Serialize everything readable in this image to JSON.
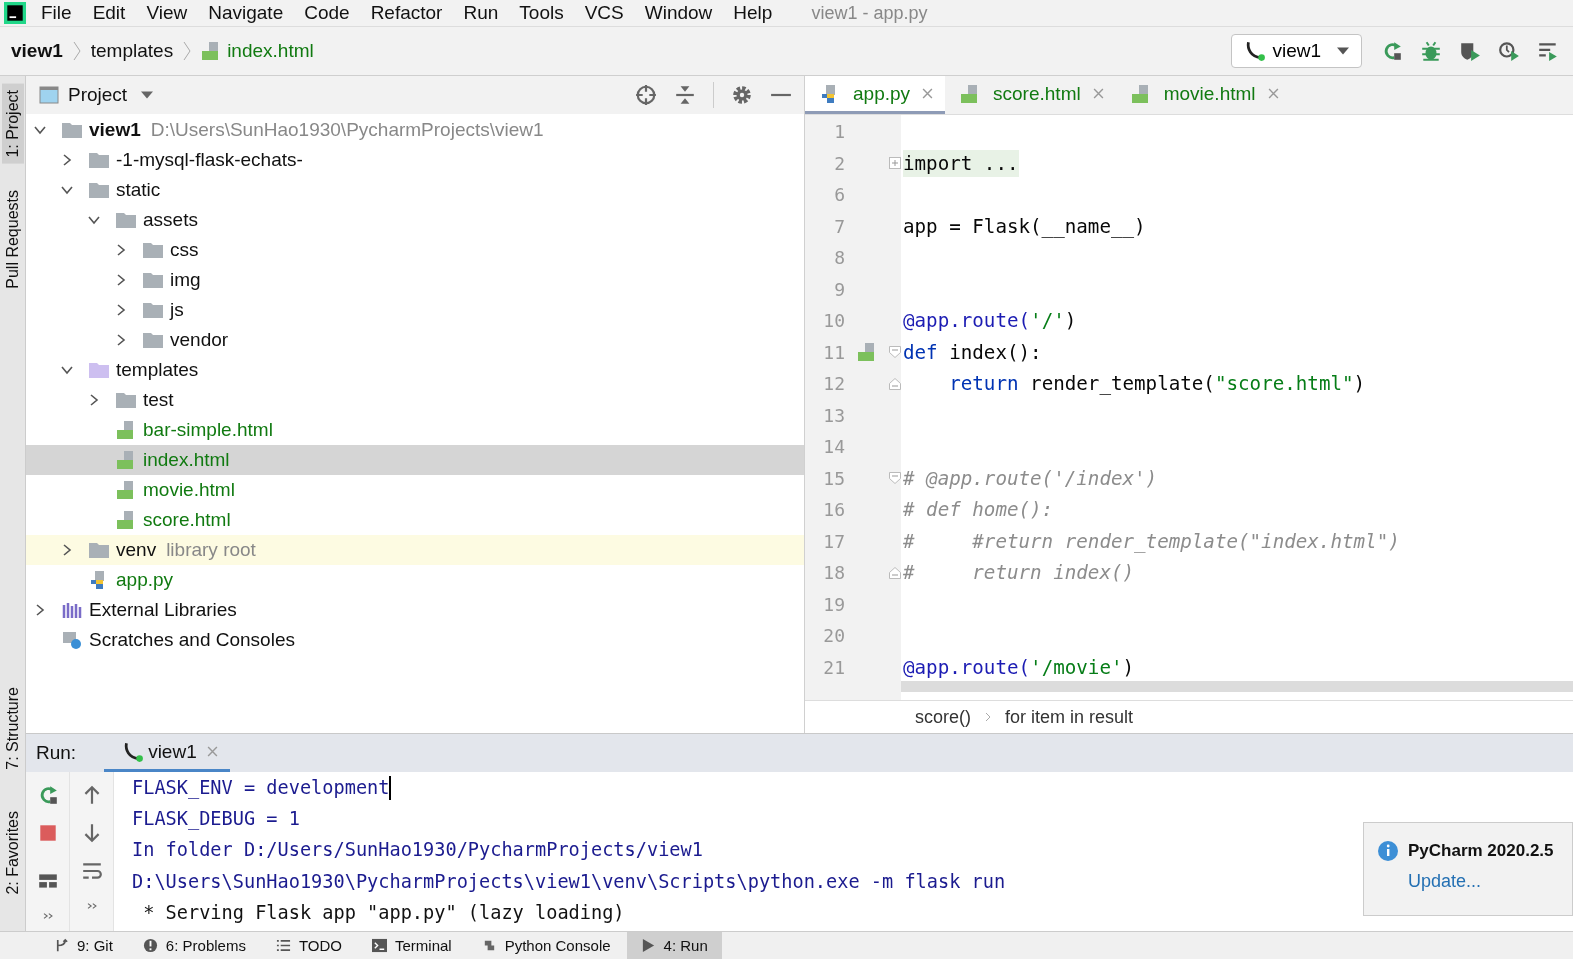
{
  "menu": [
    "File",
    "Edit",
    "View",
    "Navigate",
    "Code",
    "Refactor",
    "Run",
    "Tools",
    "VCS",
    "Window",
    "Help"
  ],
  "window": {
    "title": "view1 - app.py"
  },
  "breadcrumb": [
    {
      "label": "view1",
      "kind": "project"
    },
    {
      "label": "templates",
      "kind": "folder"
    },
    {
      "label": "index.html",
      "kind": "html"
    }
  ],
  "run_config": {
    "label": "view1"
  },
  "side_tabs": [
    {
      "label": "1: Project",
      "selected": true,
      "kind": "project"
    },
    {
      "label": "Pull Requests",
      "selected": false,
      "kind": "pull"
    },
    {
      "label": "7: Structure",
      "selected": false,
      "kind": "structure"
    },
    {
      "label": "2: Favorites",
      "selected": false,
      "kind": "favorites"
    }
  ],
  "project": {
    "title": "Project",
    "tree": [
      {
        "name": "view1",
        "path": "D:\\Users\\SunHao1930\\PycharmProjects\\view1",
        "kind": "root",
        "expanded": true,
        "selected": false,
        "children": [
          {
            "name": "-1-mysql-flask-echats-",
            "kind": "folder",
            "expanded": false,
            "selected": false
          },
          {
            "name": "static",
            "kind": "folder",
            "expanded": true,
            "selected": false,
            "children": [
              {
                "name": "assets",
                "kind": "folder",
                "expanded": true,
                "selected": false,
                "children": [
                  {
                    "name": "css",
                    "kind": "folder",
                    "expanded": false,
                    "selected": false
                  },
                  {
                    "name": "img",
                    "kind": "folder",
                    "expanded": false,
                    "selected": false
                  },
                  {
                    "name": "js",
                    "kind": "folder",
                    "expanded": false,
                    "selected": false
                  },
                  {
                    "name": "vendor",
                    "kind": "folder",
                    "expanded": false,
                    "selected": false
                  }
                ]
              }
            ]
          },
          {
            "name": "templates",
            "kind": "templates",
            "expanded": true,
            "selected": false,
            "children": [
              {
                "name": "test",
                "kind": "folder",
                "expanded": false,
                "selected": false
              },
              {
                "name": "bar-simple.html",
                "kind": "html",
                "selected": false
              },
              {
                "name": "index.html",
                "kind": "html",
                "selected": true
              },
              {
                "name": "movie.html",
                "kind": "html",
                "selected": false
              },
              {
                "name": "score.html",
                "kind": "html",
                "selected": false
              }
            ]
          },
          {
            "name": "venv",
            "note": "library root",
            "kind": "folder",
            "expanded": false,
            "selected": false
          },
          {
            "name": "app.py",
            "kind": "py",
            "selected": false
          }
        ]
      },
      {
        "name": "External Libraries",
        "kind": "libs",
        "expanded": false,
        "selected": false
      },
      {
        "name": "Scratches and Consoles",
        "kind": "scratch",
        "selected": false
      }
    ]
  },
  "editor": {
    "tabs": [
      {
        "label": "app.py",
        "kind": "py",
        "selected": true
      },
      {
        "label": "score.html",
        "kind": "html",
        "selected": false
      },
      {
        "label": "movie.html",
        "kind": "html",
        "selected": false
      }
    ],
    "lines": [
      {
        "n": "1"
      },
      {
        "n": "2",
        "fold": {
          "kind": "collapsed"
        },
        "tokens": [
          {
            "t": "import ...",
            "kind": "folded"
          }
        ]
      },
      {
        "n": "6"
      },
      {
        "n": "7",
        "tokens": [
          {
            "t": "app = Flask(__name__)",
            "kind": "plain"
          }
        ]
      },
      {
        "n": "8"
      },
      {
        "n": "9"
      },
      {
        "n": "10",
        "tokens": [
          {
            "t": "@app.route(",
            "kind": "decorator"
          },
          {
            "t": "'/'",
            "kind": "string"
          },
          {
            "t": ")",
            "kind": "plain"
          }
        ]
      },
      {
        "n": "11",
        "fold": {
          "kind": "start"
        },
        "marker": {
          "kind": "html"
        },
        "tokens": [
          {
            "t": "def",
            "kind": "keyword"
          },
          {
            "t": " index():",
            "kind": "plain"
          }
        ]
      },
      {
        "n": "12",
        "fold": {
          "kind": "end"
        },
        "tokens": [
          {
            "t": "    return",
            "kind": "keyword"
          },
          {
            "t": " render_template(",
            "kind": "plain"
          },
          {
            "t": "\"score.html\"",
            "kind": "string"
          },
          {
            "t": ")",
            "kind": "plain"
          }
        ]
      },
      {
        "n": "13"
      },
      {
        "n": "14"
      },
      {
        "n": "15",
        "fold": {
          "kind": "start"
        },
        "tokens": [
          {
            "t": "# @app.route('/index')",
            "kind": "comment"
          }
        ]
      },
      {
        "n": "16",
        "tokens": [
          {
            "t": "# def home():",
            "kind": "comment"
          }
        ]
      },
      {
        "n": "17",
        "tokens": [
          {
            "t": "#     #return render_template(\"index.html\")",
            "kind": "comment"
          }
        ]
      },
      {
        "n": "18",
        "fold": {
          "kind": "end"
        },
        "tokens": [
          {
            "t": "#     return index()",
            "kind": "comment"
          }
        ]
      },
      {
        "n": "19"
      },
      {
        "n": "20"
      },
      {
        "n": "21",
        "tokens": [
          {
            "t": "@app.route(",
            "kind": "decorator"
          },
          {
            "t": "'/movie'",
            "kind": "string"
          },
          {
            "t": ")",
            "kind": "plain"
          }
        ]
      }
    ],
    "breadcrumb": [
      "score()",
      "for item in result"
    ]
  },
  "run": {
    "label": "Run:",
    "tab": "view1",
    "output": [
      {
        "text": "FLASK_ENV = development",
        "kind": "env",
        "cursor": true
      },
      {
        "text": "FLASK_DEBUG = 1",
        "kind": "env",
        "cursor": false
      },
      {
        "text": "In folder D:/Users/SunHao1930/PycharmProjects/view1",
        "kind": "env",
        "cursor": false
      },
      {
        "text": "D:\\Users\\SunHao1930\\PycharmProjects\\view1\\venv\\Scripts\\python.exe -m flask run",
        "kind": "env",
        "cursor": false
      },
      {
        "text": " * Serving Flask app \"app.py\" (lazy loading)",
        "kind": "log",
        "cursor": false
      }
    ]
  },
  "notification": {
    "title": "PyCharm 2020.2.5",
    "link": "Update..."
  },
  "bottom_tabs": [
    {
      "label": "9: Git",
      "kind": "git",
      "selected": false
    },
    {
      "label": "6: Problems",
      "kind": "problems",
      "selected": false
    },
    {
      "label": "TODO",
      "kind": "todo",
      "selected": false
    },
    {
      "label": "Terminal",
      "kind": "terminal",
      "selected": false
    },
    {
      "label": "Python Console",
      "kind": "python",
      "selected": false
    },
    {
      "label": "4: Run",
      "kind": "run",
      "selected": true
    }
  ]
}
